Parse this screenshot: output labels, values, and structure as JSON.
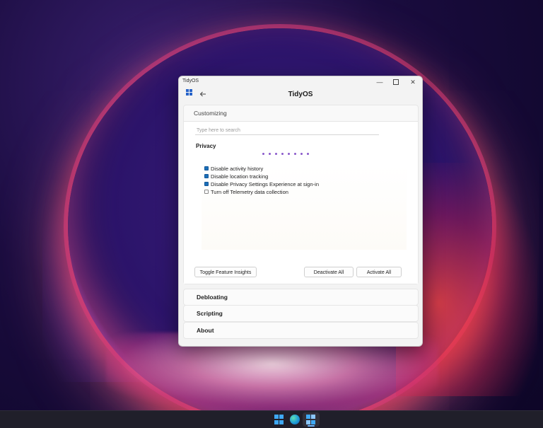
{
  "window": {
    "title": "TidyOS",
    "header_title": "TidyOS",
    "controls": {
      "minimize": "—",
      "close": "✕"
    }
  },
  "icons": {
    "back": "arrow-left",
    "app_logo": "tidyos-grid-logo",
    "taskbar": [
      "windows-start-icon",
      "edge-browser-icon",
      "tidyos-app-icon"
    ]
  },
  "customizing": {
    "heading": "Customizing",
    "search_placeholder": "Type here to search",
    "category_title": "Privacy",
    "options": [
      {
        "label": "Disable activity history",
        "checked": true
      },
      {
        "label": "Disable location tracking",
        "checked": true
      },
      {
        "label": "Disable Privacy Settings Experience at sign-in",
        "checked": true
      },
      {
        "label": "Turn off Telemetry data collection",
        "checked": false
      }
    ],
    "buttons": {
      "insights": "Toggle Feature Insights",
      "deactivate": "Deactivate All",
      "activate": "Activate All"
    }
  },
  "sections": {
    "debloating": "Debloating",
    "scripting": "Scripting",
    "about": "About"
  },
  "colors": {
    "accent": "#1c6fb8",
    "loader_dots": "#8a5acb",
    "taskbar": "#201f2a"
  }
}
